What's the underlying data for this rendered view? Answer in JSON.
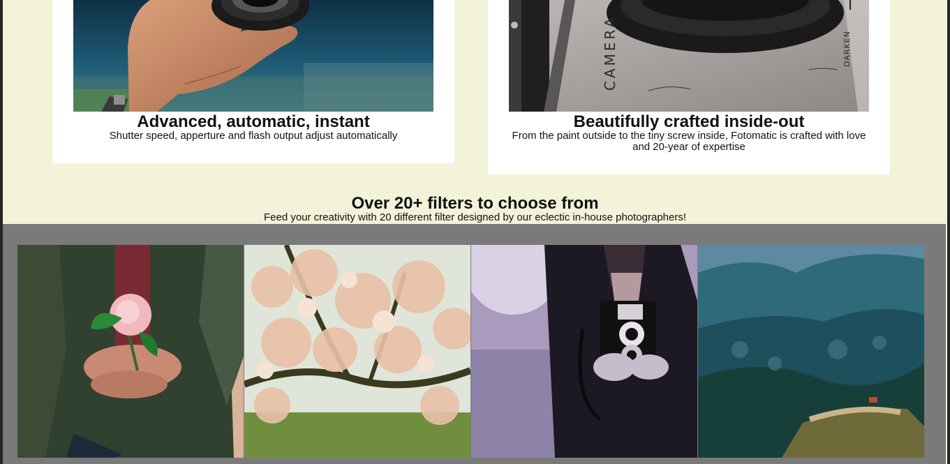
{
  "features": [
    {
      "title": "Advanced, automatic, instant",
      "description": "Shutter speed, apperture and flash output adjust automatically",
      "image_icon": "hand-holding-lens-photo"
    },
    {
      "title": "Beautifully crafted inside-out",
      "description": "From the paint outside to the tiny screw inside, Fotomatic is crafted with love and 20-year of expertise",
      "image_icon": "camera-closeup-photo",
      "image_text": {
        "camera": "CAMERA",
        "darken": "DARKEN"
      }
    }
  ],
  "filters_section": {
    "title": "Over 20+ filters to choose from",
    "subtitle": "Feed your creativity with 20 different filter designed by our eclectic in-house photographers!"
  },
  "gallery": [
    {
      "image_icon": "person-holding-flower-photo"
    },
    {
      "image_icon": "blossom-tree-photo"
    },
    {
      "image_icon": "man-with-vintage-camera-photo"
    },
    {
      "image_icon": "mountain-landscape-photo"
    }
  ],
  "colors": {
    "page_background": "#f3f3d9",
    "card_background": "#ffffff",
    "gallery_background": "#7a7a7a",
    "frame": "#262626"
  }
}
